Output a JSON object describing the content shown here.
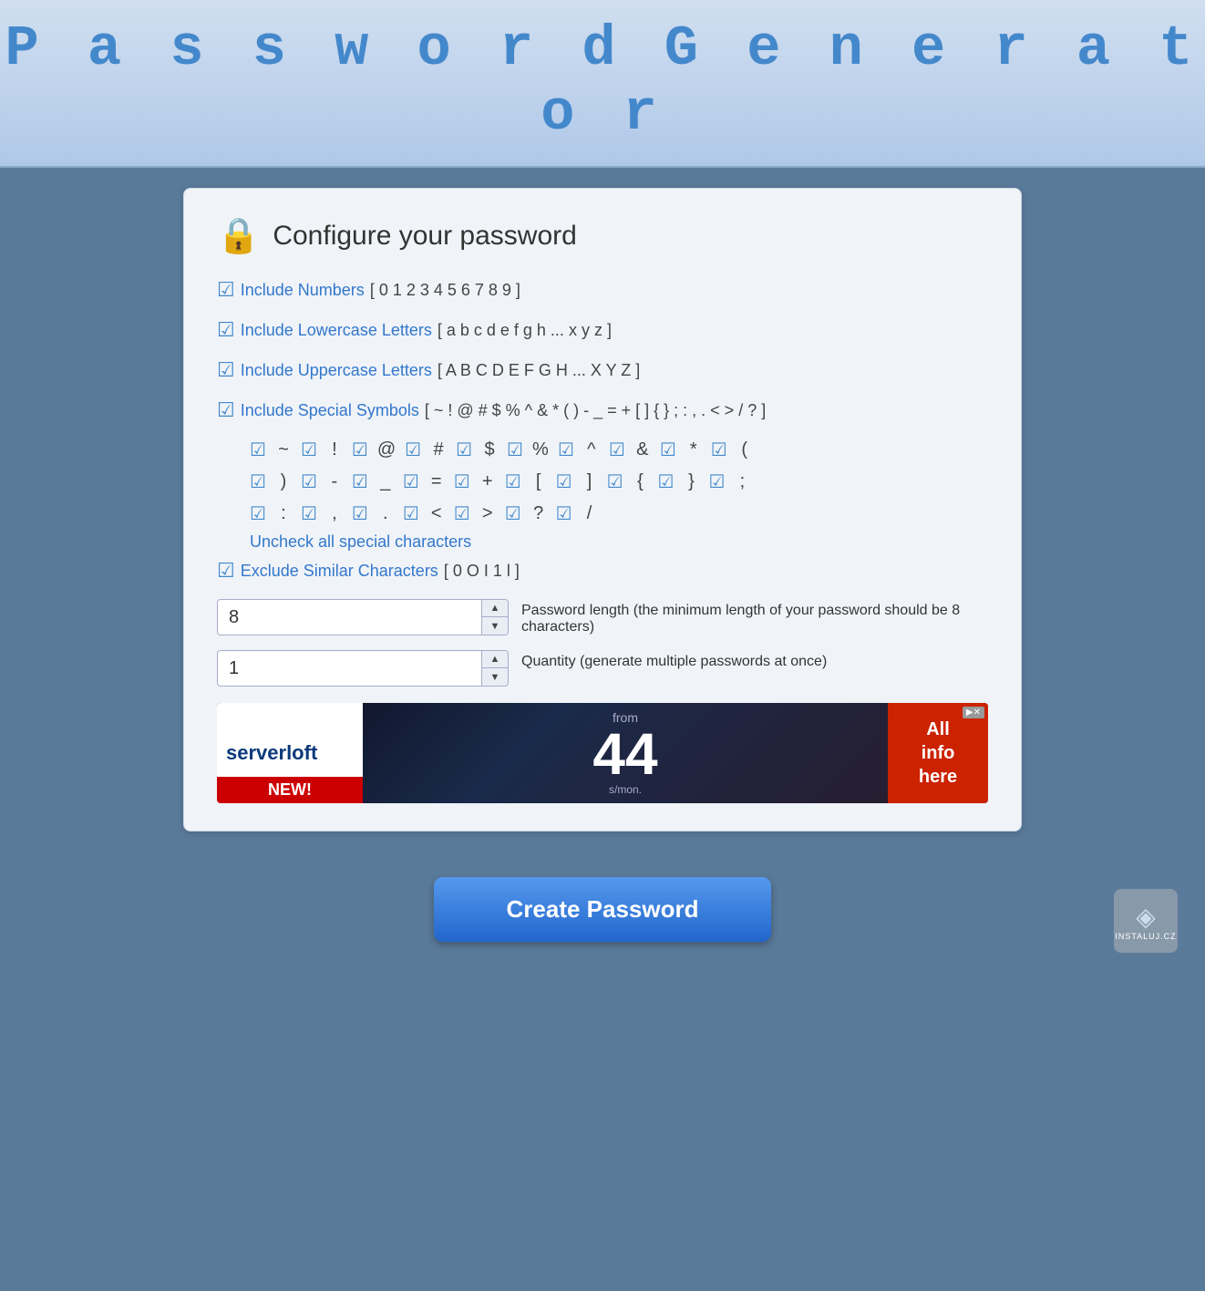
{
  "header": {
    "title": "P a s s w o r d   G e n e r a t o r"
  },
  "card": {
    "lock_icon": "🔒",
    "title": "Configure your password",
    "options": [
      {
        "id": "include-numbers",
        "label": "Include Numbers",
        "value": "[ 0 1 2 3 4 5 6 7 8 9 ]",
        "checked": true
      },
      {
        "id": "include-lowercase",
        "label": "Include Lowercase Letters",
        "value": "[ a b c d e f g h ... x y z ]",
        "checked": true
      },
      {
        "id": "include-uppercase",
        "label": "Include Uppercase Letters",
        "value": "[ A B C D E F G H ... X Y Z ]",
        "checked": true
      },
      {
        "id": "include-special",
        "label": "Include Special Symbols",
        "value": "[ ~ ! @ # $ % ^ & * ( ) - _ = + [ ] { } ; : , . < > / ? ]",
        "checked": true
      }
    ],
    "special_symbols_row1": [
      "~",
      "!",
      "@",
      "#",
      "$",
      "%",
      "^",
      "&",
      "*",
      "("
    ],
    "special_symbols_row2": [
      ")",
      "-",
      "_",
      "=",
      "+",
      "[",
      "]",
      "{",
      "}",
      ";"
    ],
    "special_symbols_row3": [
      ":",
      ",",
      ".",
      "<",
      ">",
      "?",
      "/"
    ],
    "uncheck_label": "Uncheck all special characters",
    "exclude": {
      "label": "Exclude Similar Characters",
      "value": "[ 0 O I 1 l ]",
      "checked": true
    },
    "length": {
      "label": "Password length (the minimum length of your password should be 8 characters)",
      "value": "8"
    },
    "quantity": {
      "label": "Quantity (generate multiple passwords at once)",
      "value": "1"
    }
  },
  "ad": {
    "brand": "serverloft",
    "new_label": "NEW!",
    "from_text": "from",
    "number": "44",
    "unit": "s/mon.",
    "right_text": "All\ninfo\nhere",
    "close_label": "✕"
  },
  "bottom": {
    "create_button": "Create Password",
    "instaluj_text": "INSTALUJ.CZ"
  },
  "icons": {
    "checked": "☑",
    "checkbox_checked": "✔"
  }
}
